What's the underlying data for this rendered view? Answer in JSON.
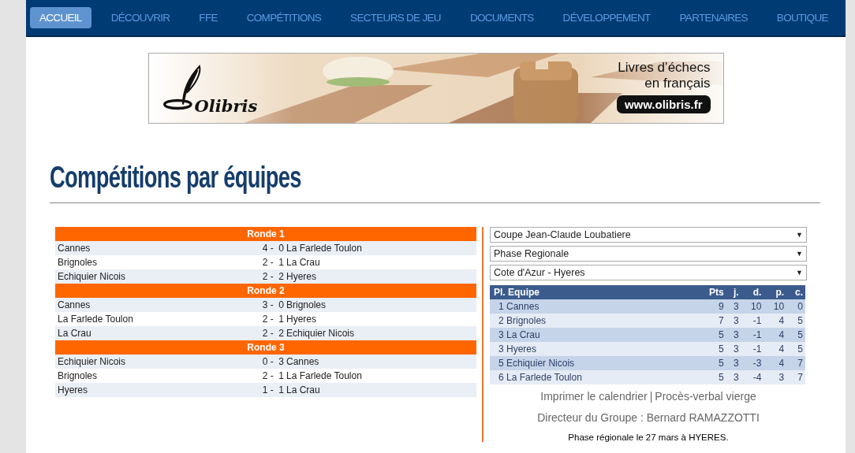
{
  "nav": [
    {
      "label": "ACCUEIL",
      "selected": true
    },
    {
      "label": "DÉCOUVRIR",
      "selected": false
    },
    {
      "label": "FFE",
      "selected": false
    },
    {
      "label": "COMPÉTITIONS",
      "selected": false
    },
    {
      "label": "SECTEURS DE JEU",
      "selected": false
    },
    {
      "label": "DOCUMENTS",
      "selected": false
    },
    {
      "label": "DÉVELOPPEMENT",
      "selected": false
    },
    {
      "label": "PARTENAIRES",
      "selected": false
    },
    {
      "label": "BOUTIQUE",
      "selected": false
    }
  ],
  "banner": {
    "logo": "Olibris",
    "lines": [
      "Livres d’échecs",
      "en français"
    ],
    "url": "www.olibris.fr"
  },
  "title": "Compétitions par équipes",
  "rounds": [
    {
      "title": "Ronde 1",
      "matches": [
        {
          "home": "Cannes",
          "score": "4 -  0",
          "away": "La Farlede Toulon"
        },
        {
          "home": "Brignoles",
          "score": "2 -  1",
          "away": "La Crau"
        },
        {
          "home": "Echiquier Nicois",
          "score": "2 -  2",
          "away": "Hyeres"
        }
      ]
    },
    {
      "title": "Ronde 2",
      "matches": [
        {
          "home": "Cannes",
          "score": "3 -  0",
          "away": "Brignoles"
        },
        {
          "home": "La Farlede Toulon",
          "score": "2 -  1",
          "away": "Hyeres"
        },
        {
          "home": "La Crau",
          "score": "2 -  2",
          "away": "Echiquier Nicois"
        }
      ]
    },
    {
      "title": "Ronde 3",
      "matches": [
        {
          "home": "Echiquier Nicois",
          "score": "0 -  3",
          "away": "Cannes"
        },
        {
          "home": "Brignoles",
          "score": "2 -  1",
          "away": "La Farlede Toulon"
        },
        {
          "home": "Hyeres",
          "score": "1 -  1",
          "away": "La Crau"
        }
      ]
    }
  ],
  "filters": [
    {
      "value": "Coupe Jean-Claude Loubatiere",
      "caret": "▼"
    },
    {
      "value": "Phase Regionale",
      "caret": "▼"
    },
    {
      "value": "Cote d'Azur - Hyeres",
      "caret": "▼"
    }
  ],
  "standings": {
    "columns": [
      "Pl. Equipe",
      "Pts",
      "j.",
      "d.",
      "p.",
      "c."
    ],
    "rows": [
      {
        "rank": "1",
        "team": "Cannes",
        "pts": "9",
        "j": "3",
        "d": "10",
        "p": "10",
        "c": "0"
      },
      {
        "rank": "2",
        "team": "Brignoles",
        "pts": "7",
        "j": "3",
        "d": "-1",
        "p": "4",
        "c": "5"
      },
      {
        "rank": "3",
        "team": "La Crau",
        "pts": "5",
        "j": "3",
        "d": "-1",
        "p": "4",
        "c": "5"
      },
      {
        "rank": "3",
        "team": "Hyeres",
        "pts": "5",
        "j": "3",
        "d": "-1",
        "p": "4",
        "c": "5"
      },
      {
        "rank": "5",
        "team": "Echiquier Nicois",
        "pts": "5",
        "j": "3",
        "d": "-3",
        "p": "4",
        "c": "7"
      },
      {
        "rank": "6",
        "team": "La Farlede Toulon",
        "pts": "5",
        "j": "3",
        "d": "-4",
        "p": "3",
        "c": "7"
      }
    ]
  },
  "footer": {
    "links": [
      "Imprimer le calendrier",
      "Procès-verbal vierge"
    ],
    "separator": "|",
    "director": "Directeur du Groupe : Bernard RAMAZZOTTI",
    "note": "Phase régionale le 27 mars à HYERES."
  }
}
